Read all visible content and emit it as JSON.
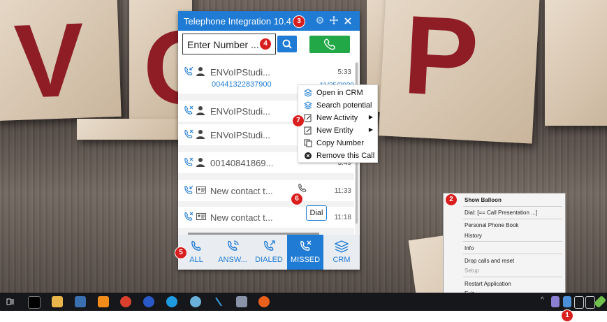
{
  "window": {
    "title": "Telephone Integration 10.4",
    "number_placeholder": "Enter Number ..."
  },
  "calls": [
    {
      "name": "ENVoIPStudi...",
      "time": "5:33",
      "number": "00441322837900",
      "date": "11/25/2020",
      "type": "answered",
      "contact": "person"
    },
    {
      "name": "ENVoIPStudi...",
      "time": "",
      "type": "missed",
      "contact": "person"
    },
    {
      "name": "ENVoIPStudi...",
      "time": "",
      "type": "missed",
      "contact": "person"
    },
    {
      "name": "00140841869...",
      "time": "3:49",
      "type": "missed",
      "contact": "person"
    },
    {
      "name": "New contact t...",
      "time": "11:33",
      "type": "answered",
      "contact": "card"
    },
    {
      "name": "New contact t...",
      "time": "11:18",
      "type": "missed",
      "contact": "card"
    }
  ],
  "dial_tooltip": "Dial",
  "tabs": [
    {
      "label": "ALL",
      "icon": "phone-icon"
    },
    {
      "label": "ANSW...",
      "icon": "incoming-call-icon"
    },
    {
      "label": "DIALED",
      "icon": "outgoing-call-icon"
    },
    {
      "label": "MISSED",
      "icon": "missed-call-icon",
      "active": true
    },
    {
      "label": "CRM",
      "icon": "layers-icon"
    }
  ],
  "context_menu": [
    {
      "label": "Open in CRM",
      "icon": "layers-icon"
    },
    {
      "label": "Search potential",
      "icon": "layers-icon"
    },
    {
      "label": "New Activity",
      "icon": "edit-icon",
      "submenu": true
    },
    {
      "label": "New Entity",
      "icon": "edit-icon",
      "submenu": true
    },
    {
      "label": "Copy Number",
      "icon": "copy-icon"
    },
    {
      "label": "Remove this Call",
      "icon": "remove-icon"
    }
  ],
  "tray_menu": [
    {
      "label": "Show Balloon",
      "bold": true
    },
    {
      "label": "Dial: [== Call Presentation ...]"
    },
    {
      "label": "Personal Phone Book"
    },
    {
      "label": "History"
    },
    {
      "label": "Info"
    },
    {
      "label": "Drop calls and reset"
    },
    {
      "label": "Setup",
      "disabled": true
    },
    {
      "label": "Restart Application"
    },
    {
      "label": "Exit"
    }
  ],
  "badges": [
    "1",
    "2",
    "3",
    "4",
    "5",
    "6",
    "7"
  ],
  "colors": {
    "accent": "#1f7bd4",
    "call_green": "#22a846",
    "badge_red": "#d91e1e"
  }
}
